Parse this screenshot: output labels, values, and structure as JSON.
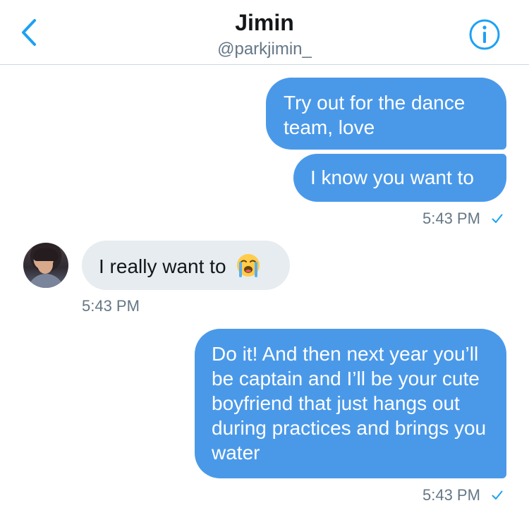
{
  "header": {
    "title": "Jimin",
    "handle": "@parkjimin_",
    "back_icon": "chevron-left-icon",
    "info_icon": "info-icon"
  },
  "messages": [
    {
      "direction": "outgoing",
      "text": "Try out for the dance team, love"
    },
    {
      "direction": "outgoing",
      "text": "I know you want to"
    },
    {
      "direction": "incoming",
      "text": "I really want to",
      "emoji": "loudly-crying-face"
    },
    {
      "direction": "outgoing",
      "text": "Do it! And then next year you’ll be captain and I’ll be your cute boyfriend that just hangs out during practices and brings you water"
    }
  ],
  "timestamps": {
    "first": "5:43 PM",
    "second": "5:43 PM",
    "third": "5:43 PM"
  },
  "colors": {
    "accent": "#1da1f2",
    "outgoing_bubble": "#4a99e9",
    "incoming_bubble": "#e6ecf0",
    "secondary_text": "#657786"
  }
}
